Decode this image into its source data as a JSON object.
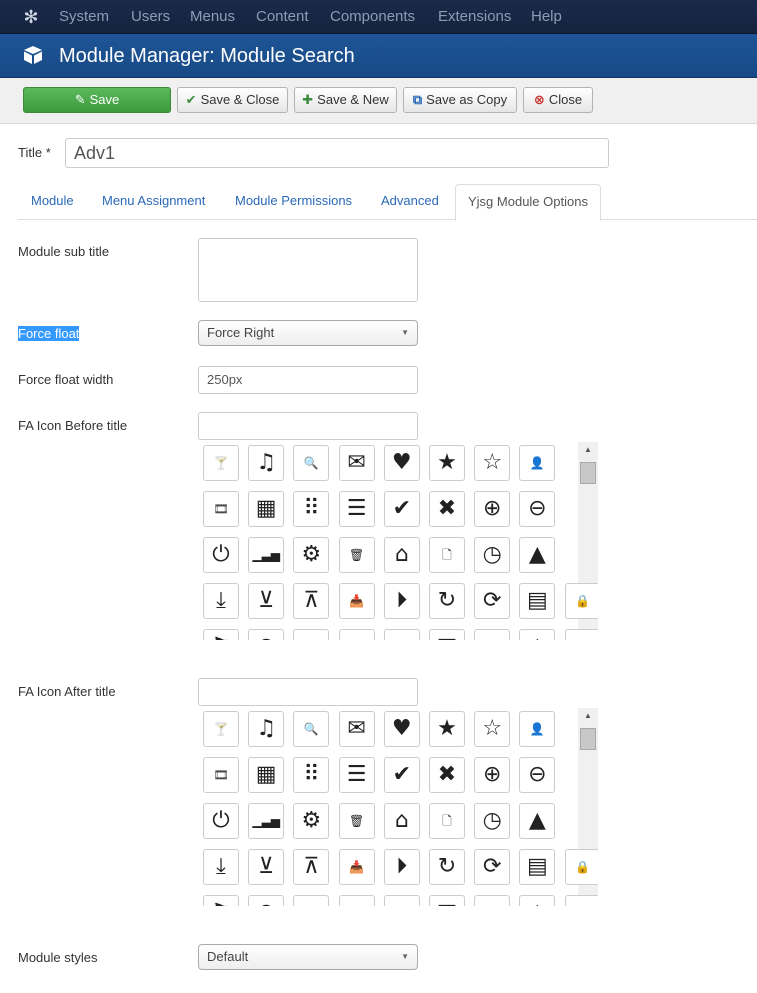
{
  "topnav": {
    "logo_icon": "joomla-icon",
    "items": [
      {
        "label": "System"
      },
      {
        "label": "Users"
      },
      {
        "label": "Menus"
      },
      {
        "label": "Content"
      },
      {
        "label": "Components"
      },
      {
        "label": "Extensions"
      },
      {
        "label": "Help"
      }
    ]
  },
  "header": {
    "title": "Module Manager: Module Search",
    "icon": "cube-icon"
  },
  "toolbar": {
    "save": "Save",
    "save_close": "Save & Close",
    "save_new": "Save & New",
    "save_copy": "Save as Copy",
    "close": "Close"
  },
  "form": {
    "title_label": "Title *",
    "title_value": "Adv1"
  },
  "tabs": [
    {
      "label": "Module"
    },
    {
      "label": "Menu Assignment"
    },
    {
      "label": "Module Permissions"
    },
    {
      "label": "Advanced"
    },
    {
      "label": "Yjsg Module Options"
    }
  ],
  "options": {
    "subtitle_label": "Module sub title",
    "subtitle_value": "",
    "force_float_label": "Force float",
    "force_float_value": "Force Right",
    "float_width_label": "Force float width",
    "float_width_value": "250px",
    "icon_before_label": "FA Icon Before title",
    "icon_before_value": "",
    "icon_after_label": "FA Icon After title",
    "icon_after_value": "",
    "module_styles_label": "Module styles",
    "module_styles_value": "Default"
  },
  "icon_rows": [
    [
      {
        "name": "glass-icon",
        "glyph": "🍸"
      },
      {
        "name": "music-icon",
        "glyph": "♫"
      },
      {
        "name": "search-icon",
        "glyph": "🔍"
      },
      {
        "name": "envelope-icon",
        "glyph": "✉"
      },
      {
        "name": "heart-icon",
        "glyph": "♥"
      },
      {
        "name": "star-icon",
        "glyph": "★"
      },
      {
        "name": "star-empty-icon",
        "glyph": "☆"
      },
      {
        "name": "user-icon",
        "glyph": "👤"
      }
    ],
    [
      {
        "name": "film-icon",
        "glyph": "🎞"
      },
      {
        "name": "th-large-icon",
        "glyph": "▦"
      },
      {
        "name": "th-icon",
        "glyph": "⠿"
      },
      {
        "name": "th-list-icon",
        "glyph": "☰"
      },
      {
        "name": "check-icon",
        "glyph": "✔"
      },
      {
        "name": "remove-icon",
        "glyph": "✖"
      },
      {
        "name": "zoom-in-icon",
        "glyph": "⊕"
      },
      {
        "name": "zoom-out-icon",
        "glyph": "⊖"
      }
    ],
    [
      {
        "name": "power-off-icon",
        "glyph": "⏻"
      },
      {
        "name": "signal-icon",
        "glyph": "▁▃▅"
      },
      {
        "name": "cog-icon",
        "glyph": "⚙"
      },
      {
        "name": "trash-icon",
        "glyph": "🗑"
      },
      {
        "name": "home-icon",
        "glyph": "⌂"
      },
      {
        "name": "file-icon",
        "glyph": "🗋"
      },
      {
        "name": "clock-icon",
        "glyph": "◷"
      },
      {
        "name": "road-icon",
        "glyph": "▲"
      }
    ],
    [
      {
        "name": "download-icon",
        "glyph": "⤓"
      },
      {
        "name": "arrow-circle-down-icon",
        "glyph": "⊻"
      },
      {
        "name": "arrow-circle-up-icon",
        "glyph": "⊼"
      },
      {
        "name": "inbox-icon",
        "glyph": "📥"
      },
      {
        "name": "play-circle-icon",
        "glyph": "⏵"
      },
      {
        "name": "repeat-icon",
        "glyph": "↻"
      },
      {
        "name": "refresh-icon",
        "glyph": "⟳"
      },
      {
        "name": "list-alt-icon",
        "glyph": "▤"
      },
      {
        "name": "lock-icon",
        "glyph": "🔒"
      }
    ],
    [
      {
        "name": "flag-icon",
        "glyph": "⚑"
      },
      {
        "name": "headphones-icon",
        "glyph": "◠"
      },
      {
        "name": "volume-off-icon",
        "glyph": "◂"
      },
      {
        "name": "volume-down-icon",
        "glyph": "◂"
      },
      {
        "name": "volume-up-icon",
        "glyph": "◂)"
      },
      {
        "name": "qrcode-icon",
        "glyph": "▩"
      },
      {
        "name": "barcode-icon",
        "glyph": "|||"
      },
      {
        "name": "tag-icon",
        "glyph": "◆"
      },
      {
        "name": "tags-icon",
        "glyph": "◆◆"
      }
    ]
  ]
}
